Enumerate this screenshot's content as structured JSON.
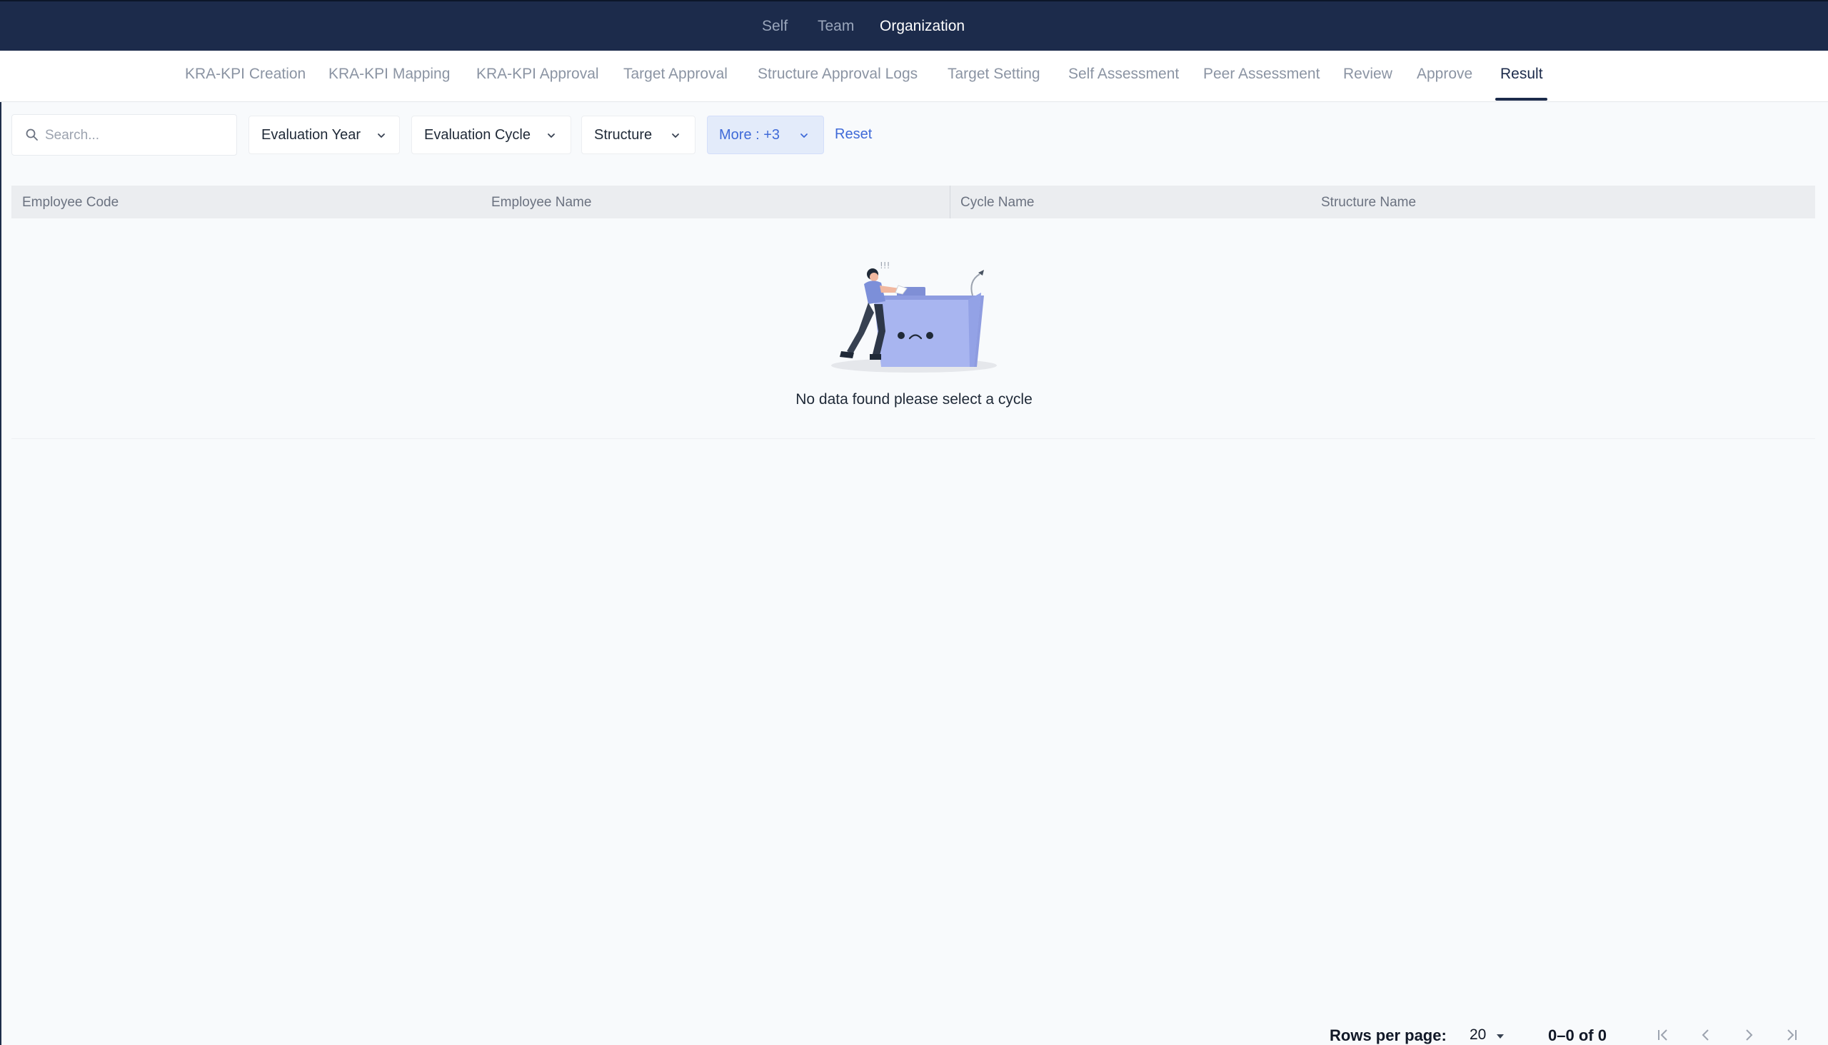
{
  "top_nav": {
    "items": [
      {
        "label": "Self",
        "active": false
      },
      {
        "label": "Team",
        "active": false
      },
      {
        "label": "Organization",
        "active": true
      }
    ]
  },
  "sub_tabs": {
    "items": [
      {
        "label": "KRA-KPI Creation"
      },
      {
        "label": "KRA-KPI Mapping"
      },
      {
        "label": "KRA-KPI Approval"
      },
      {
        "label": "Target Approval"
      },
      {
        "label": "Structure Approval Logs"
      },
      {
        "label": "Target Setting"
      },
      {
        "label": "Self Assessment"
      },
      {
        "label": "Peer Assessment"
      },
      {
        "label": "Review"
      },
      {
        "label": "Approve"
      },
      {
        "label": "Result"
      }
    ],
    "active": "Result"
  },
  "filters": {
    "search_placeholder": "Search...",
    "evaluation_year": "Evaluation Year",
    "evaluation_cycle": "Evaluation Cycle",
    "structure": "Structure",
    "more": "More : +3",
    "reset": "Reset"
  },
  "table": {
    "columns": [
      "Employee Code",
      "Employee Name",
      "Cycle Name",
      "Structure Name"
    ],
    "rows": [],
    "empty_message": "No data found please select a cycle"
  },
  "pagination": {
    "rows_per_page_label": "Rows per page:",
    "rows_per_page": "20",
    "range": "0–0 of 0"
  },
  "colors": {
    "nav_bg": "#1c2b4b",
    "accent": "#3f6ad8",
    "more_bg": "#e3ebfa",
    "header_bg": "#ebedf0",
    "page_bg": "#f8fafc"
  }
}
